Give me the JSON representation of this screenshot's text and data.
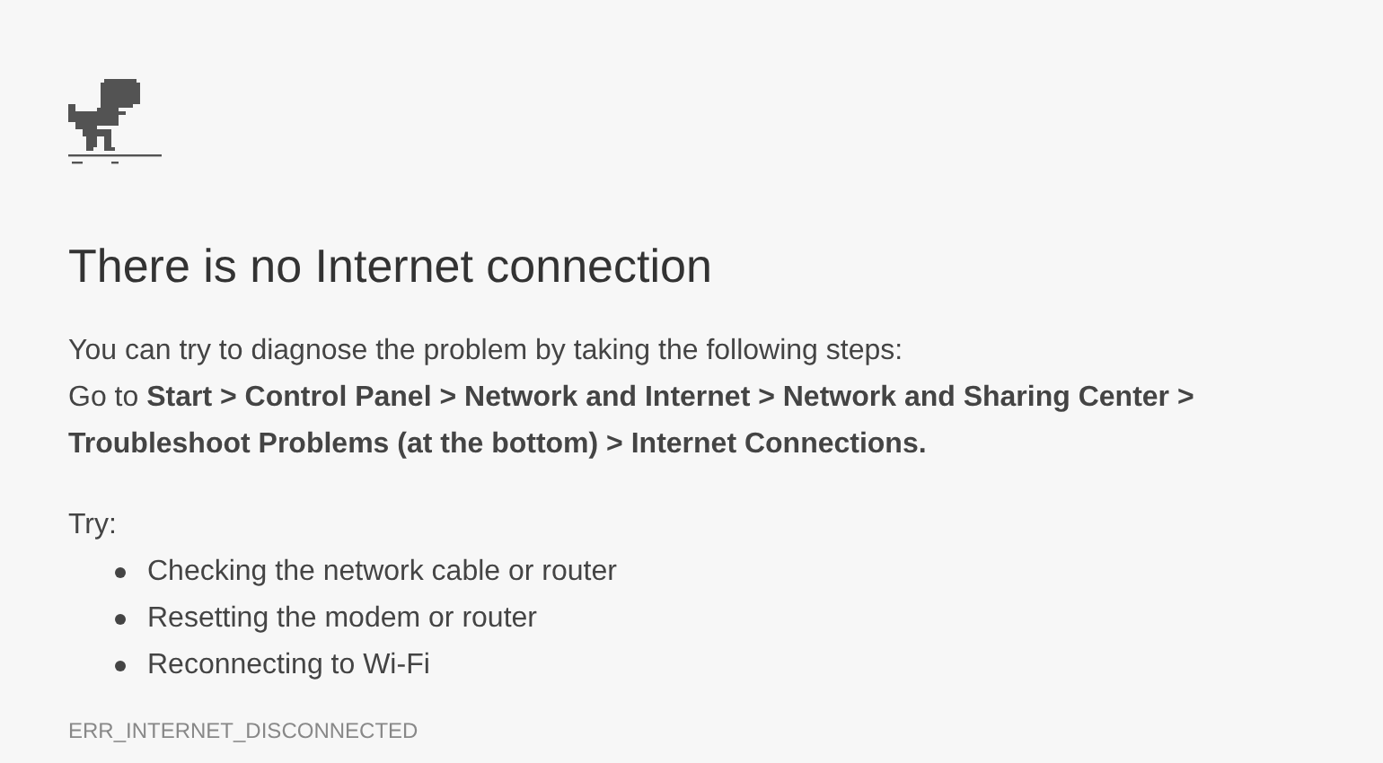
{
  "title": "There is no Internet connection",
  "intro": "You can try to diagnose the problem by taking the following steps:",
  "instructions": "Go to **Start > Control Panel > Network and Internet > Network and Sharing Center > Troubleshoot Problems (at the bottom) > Internet Connections.**",
  "try_label": "Try:",
  "suggestions": [
    "Checking the network cable or router",
    "Resetting the modem or router",
    "Reconnecting to Wi-Fi"
  ],
  "error_code": "ERR_INTERNET_DISCONNECTED"
}
